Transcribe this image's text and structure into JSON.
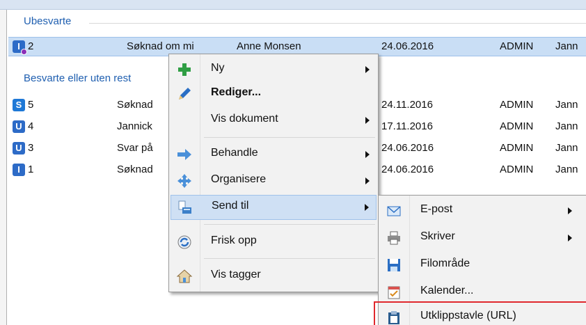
{
  "groups": {
    "unanswered": "Ubesvarte",
    "answered": "Besvarte eller uten rest"
  },
  "rows": [
    {
      "badge": "I",
      "num": "2",
      "title": "Søknad om mi",
      "person": "Anne Monsen",
      "date": "24.06.2016",
      "user": "ADMIN",
      "owner": "Jann"
    },
    {
      "badge": "S",
      "num": "5",
      "title": "Søknad",
      "date": "24.11.2016",
      "user": "ADMIN",
      "owner": "Jann"
    },
    {
      "badge": "U",
      "num": "4",
      "title": "Jannick",
      "date": "17.11.2016",
      "user": "ADMIN",
      "owner": "Jann"
    },
    {
      "badge": "U",
      "num": "3",
      "title": "Svar på",
      "date": "24.06.2016",
      "user": "ADMIN",
      "owner": "Jann"
    },
    {
      "badge": "I",
      "num": "1",
      "title": "Søknad",
      "date": "24.06.2016",
      "user": "ADMIN",
      "owner": "Jann"
    }
  ],
  "context_menu": {
    "items": [
      {
        "label": "Ny",
        "icon": "plus-icon"
      },
      {
        "label": "Rediger...",
        "icon": "pencil-icon"
      },
      {
        "label": "Vis dokument",
        "icon": ""
      },
      {
        "label": "Behandle",
        "icon": "arrow-right-icon"
      },
      {
        "label": "Organisere",
        "icon": "move-icon"
      },
      {
        "label": "Send til",
        "icon": "send-to-icon"
      },
      {
        "label": "Frisk opp",
        "icon": "refresh-icon"
      },
      {
        "label": "Vis tagger",
        "icon": "tag-home-icon"
      }
    ]
  },
  "submenu": {
    "items": [
      {
        "label": "E-post",
        "icon": "envelope-icon"
      },
      {
        "label": "Skriver",
        "icon": "printer-icon"
      },
      {
        "label": "Filområde",
        "icon": "floppy-icon"
      },
      {
        "label": "Kalender...",
        "icon": "calendar-icon"
      },
      {
        "label": "Utklippstavle (URL)",
        "icon": "clipboard-icon"
      }
    ]
  },
  "colors": {
    "selection": "#c9def5",
    "group_header": "#1f5fb0",
    "highlight_box": "#e0282d"
  }
}
